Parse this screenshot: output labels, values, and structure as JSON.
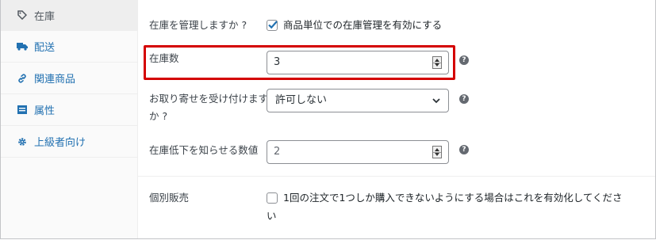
{
  "tabs": [
    {
      "label": "在庫",
      "icon": "tag-icon",
      "active": true
    },
    {
      "label": "配送",
      "icon": "truck-icon",
      "active": false
    },
    {
      "label": "関連商品",
      "icon": "link-icon",
      "active": false
    },
    {
      "label": "属性",
      "icon": "list-icon",
      "active": false
    },
    {
      "label": "上級者向け",
      "icon": "gear-icon",
      "active": false
    }
  ],
  "fields": {
    "manage_stock": {
      "label": "在庫を管理しますか ?",
      "checkbox_label": "商品単位での在庫管理を有効にする",
      "checked": true
    },
    "stock_qty": {
      "label": "在庫数",
      "value": "3",
      "help": "?"
    },
    "backorders": {
      "label_line1": "お取り寄せを受け付けます",
      "label_line2": "か ?",
      "selected": "許可しない",
      "help": "?"
    },
    "low_stock": {
      "label": "在庫低下を知らせる数値",
      "value": "2",
      "help": "?"
    },
    "sold_individually": {
      "label": "個別販売",
      "checkbox_label_line1": "1回の注文で1つしか購入できないようにする場合はこれを有効化してくださ",
      "checkbox_label_line2": "い",
      "checked": false
    }
  },
  "colors": {
    "accent": "#2271b1",
    "highlight": "#d40000",
    "checkbox": "#2271b1"
  }
}
